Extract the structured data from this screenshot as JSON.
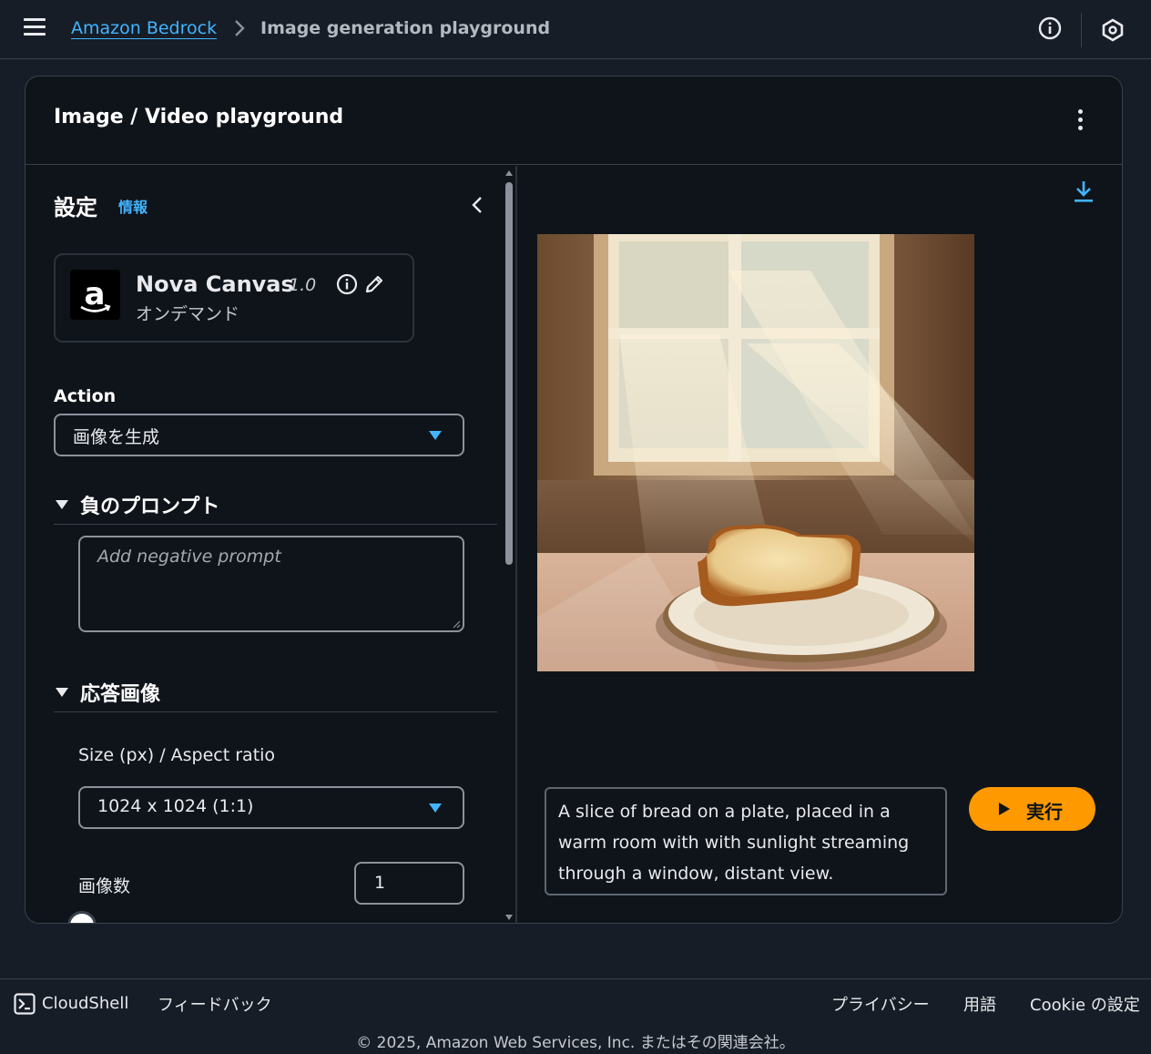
{
  "topbar": {
    "breadcrumb_link": "Amazon Bedrock",
    "breadcrumb_current": "Image generation playground"
  },
  "container": {
    "title": "Image / Video playground"
  },
  "settings": {
    "title": "設定",
    "info_link": "情報",
    "model": {
      "name": "Nova Canvas",
      "version": "1.0",
      "mode": "オンデマンド"
    },
    "action_label": "Action",
    "action_value": "画像を生成",
    "negative_prompt_section": "負のプロンプト",
    "negative_prompt_placeholder": "Add negative prompt",
    "response_image_section": "応答画像",
    "size_label": "Size (px) / Aspect ratio",
    "size_value": "1024 x 1024 (1:1)",
    "image_count_label": "画像数",
    "image_count_value": "1"
  },
  "output": {
    "prompt_text": "A slice of bread on a plate, placed in a warm room with with sunlight streaming through a window, distant view.",
    "run_label": "実行"
  },
  "footer": {
    "cloudshell": "CloudShell",
    "feedback": "フィードバック",
    "privacy": "プライバシー",
    "terms": "用語",
    "cookie": "Cookie の設定",
    "copyright": "© 2025, Amazon Web Services, Inc. またはその関連会社。"
  },
  "colors": {
    "accent_link": "#42b4ff",
    "primary_button": "#ff9900",
    "background": "#161d26",
    "panel": "#0f141a"
  },
  "icons": [
    "menu-icon",
    "chevron-right-icon",
    "info-icon",
    "settings-icon",
    "kebab-icon",
    "chevron-left-icon",
    "amazon-logo",
    "edit-icon",
    "caret-down-icon",
    "triangle-down-icon",
    "download-icon",
    "play-icon",
    "cloudshell-icon"
  ]
}
